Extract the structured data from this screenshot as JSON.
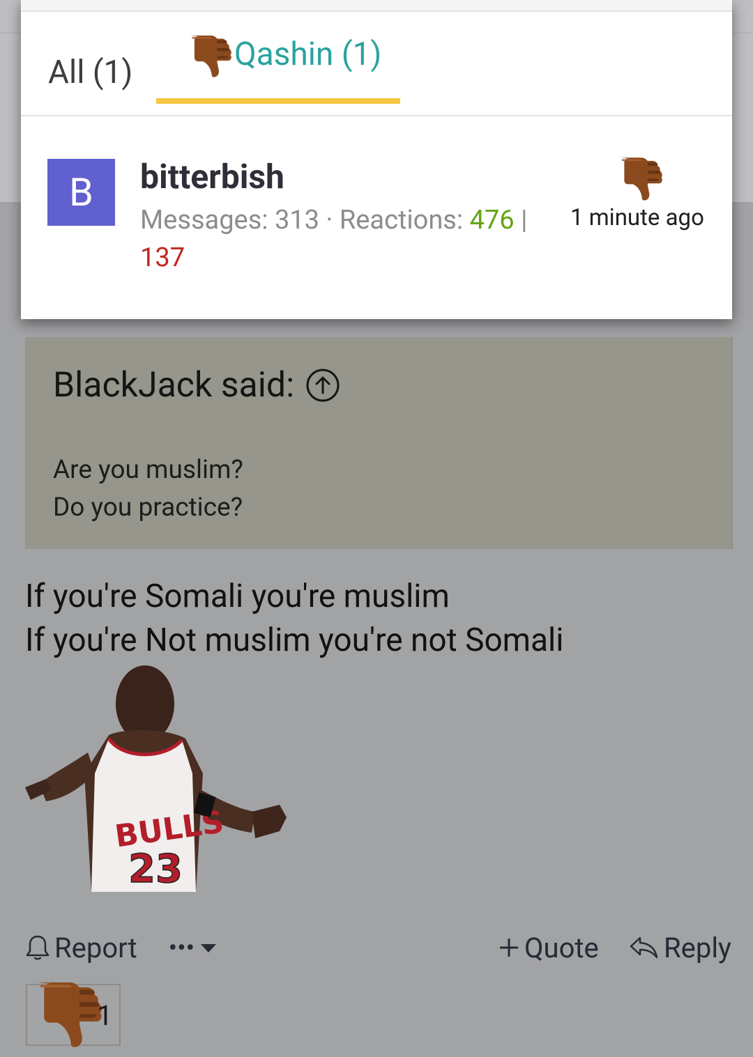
{
  "popup": {
    "tabs": [
      {
        "label": "All (1)",
        "active": false
      },
      {
        "label": "Qashin (1)",
        "active": true,
        "icon": "thumbs-down-icon"
      }
    ],
    "member": {
      "avatar_letter": "B",
      "avatar_color": "#6060d0",
      "username": "bitterbish",
      "messages_label": "Messages: 313",
      "reactions_label": "Reactions:",
      "reactions_positive": "476",
      "reactions_separator": "|",
      "reactions_negative": "137",
      "reaction_icon": "thumbs-down-icon",
      "time": "1 minute ago"
    }
  },
  "quote": {
    "author": "BlackJack said:",
    "lines": [
      "Are you muslim?",
      "Do you practice?"
    ]
  },
  "post": {
    "lines": [
      "If you're Somali you're muslim",
      "If you're Not muslim you're not Somali"
    ],
    "image": "bulls-23-player-shrug-image"
  },
  "actions": {
    "report": "Report",
    "more": "•••",
    "quote": "Quote",
    "reply": "Reply"
  },
  "reactions_bar": {
    "icon": "thumbs-down-icon",
    "count": "1"
  },
  "colors": {
    "accent_teal": "#2aa39e",
    "tab_underline": "#f5c842",
    "positive": "#63a513",
    "negative": "#c0281f"
  }
}
